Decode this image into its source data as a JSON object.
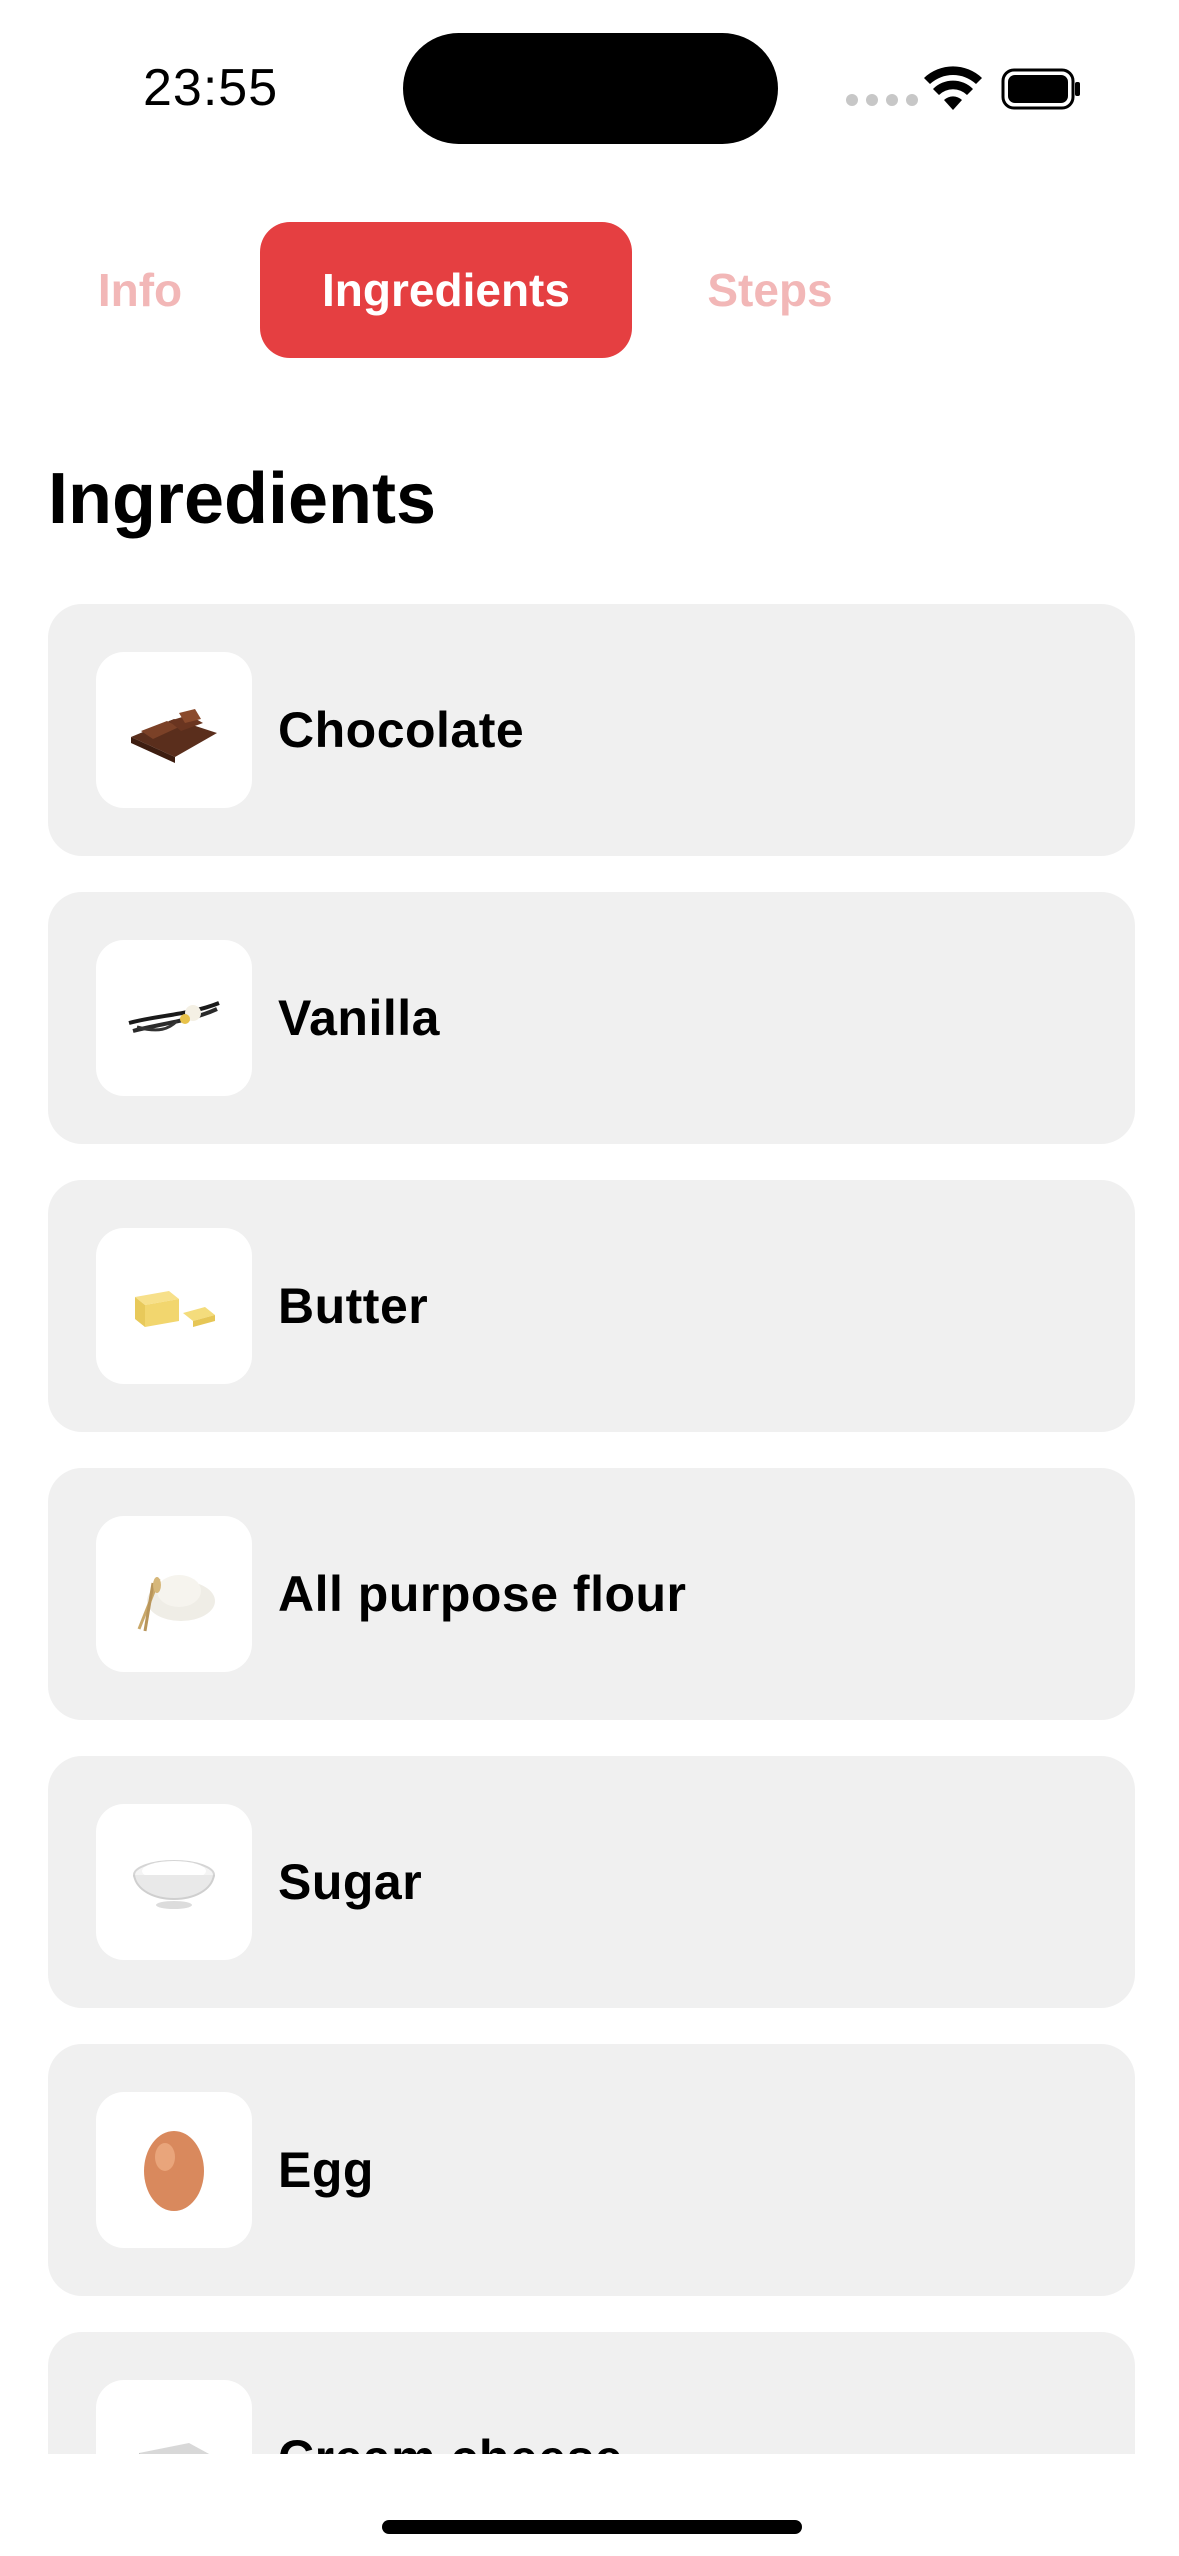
{
  "status_bar": {
    "time": "23:55"
  },
  "tabs": [
    {
      "label": "Info"
    },
    {
      "label": "Ingredients"
    },
    {
      "label": "Steps"
    }
  ],
  "section_title": "Ingredients",
  "ingredients": [
    {
      "name": "Chocolate",
      "icon": "chocolate-icon"
    },
    {
      "name": "Vanilla",
      "icon": "vanilla-icon"
    },
    {
      "name": "Butter",
      "icon": "butter-icon"
    },
    {
      "name": "All purpose flour",
      "icon": "flour-icon"
    },
    {
      "name": "Sugar",
      "icon": "sugar-icon"
    },
    {
      "name": "Egg",
      "icon": "egg-icon"
    },
    {
      "name": "Cream cheese",
      "icon": "cream-cheese-icon"
    }
  ],
  "colors": {
    "accent": "#e53f41",
    "tab_inactive": "#f2b7b7",
    "card_background": "#f0f0f0"
  }
}
